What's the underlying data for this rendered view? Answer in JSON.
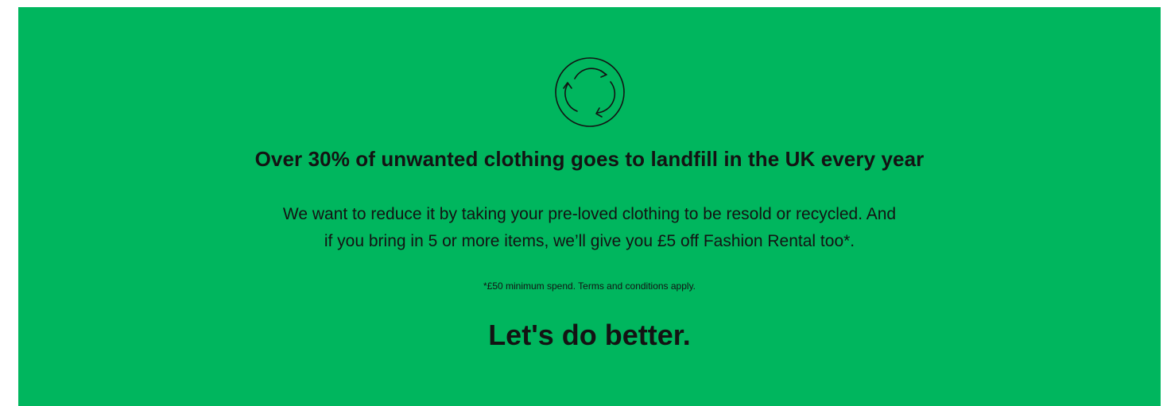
{
  "banner": {
    "background_color": "#00b65e",
    "text_color": "#131313",
    "icon": "recycle-arrows-icon",
    "headline": "Over 30% of unwanted clothing goes to landfill in the UK every year",
    "body_line_1": "We want to reduce it by taking your pre-loved clothing to be resold or recycled. And",
    "body_line_2": "if you bring in 5 or more items, we’ll give you £5 off Fashion Rental too*.",
    "terms": "*£50 minimum spend. Terms and conditions apply.",
    "cta": "Let's do better."
  }
}
